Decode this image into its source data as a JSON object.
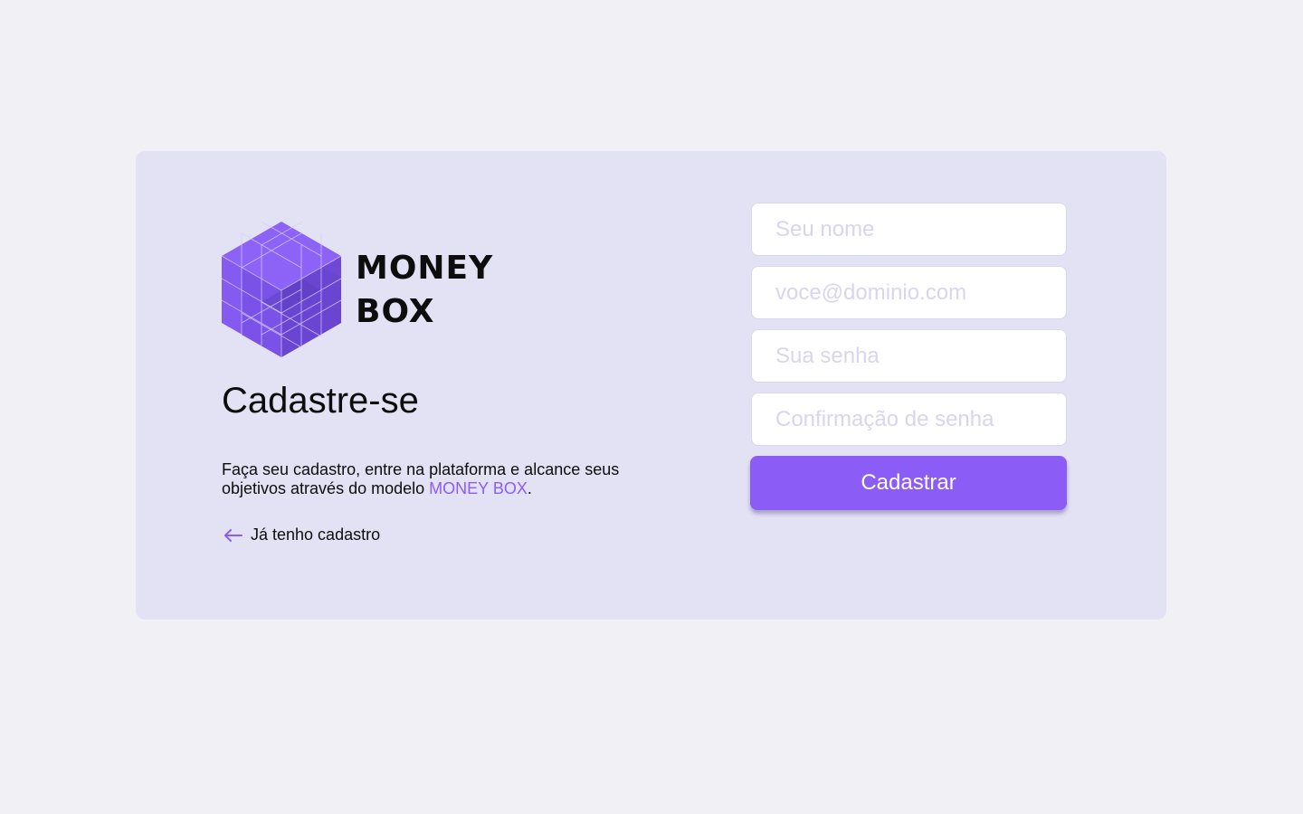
{
  "brand": {
    "line1": "MONEY",
    "line2": "BOX",
    "logo_icon": "cube-grid-logo-icon",
    "accent_color": "#8b5cf6"
  },
  "signup": {
    "title": "Cadastre-se",
    "description_prefix": "Faça seu cadastro, entre na plataforma e alcance seus objetivos através do modelo ",
    "description_highlight": "MONEY BOX",
    "description_suffix": ".",
    "back_link_label": "Já tenho cadastro",
    "back_link_icon": "arrow-left-icon"
  },
  "form": {
    "name_placeholder": "Seu nome",
    "email_placeholder": "voce@dominio.com",
    "password_placeholder": "Sua senha",
    "confirm_password_placeholder": "Confirmação de senha",
    "submit_label": "Cadastrar"
  }
}
